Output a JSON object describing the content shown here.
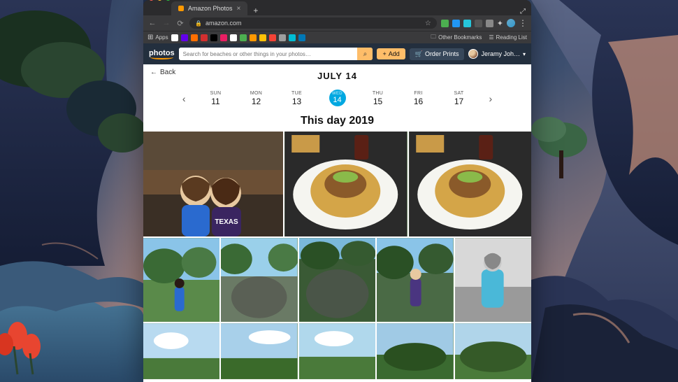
{
  "browser": {
    "tab_title": "Amazon Photos",
    "url_host": "amazon.com",
    "bookmarks": {
      "apps_label": "Apps",
      "other_label": "Other Bookmarks",
      "reading_label": "Reading List"
    }
  },
  "header": {
    "logo": "photos",
    "search_placeholder": "Search for beaches or other things in your photos…",
    "add_label": "Add",
    "order_label": "Order Prints",
    "user_name": "Jeramy Joh…"
  },
  "page": {
    "back_label": "Back",
    "title": "JULY 14",
    "year_heading": "This day 2019"
  },
  "days": [
    {
      "dow": "SUN",
      "num": "11",
      "selected": false
    },
    {
      "dow": "MON",
      "num": "12",
      "selected": false
    },
    {
      "dow": "TUE",
      "num": "13",
      "selected": false
    },
    {
      "dow": "WED",
      "num": "14",
      "selected": true
    },
    {
      "dow": "THU",
      "num": "15",
      "selected": false
    },
    {
      "dow": "FRI",
      "num": "16",
      "selected": false
    },
    {
      "dow": "SAT",
      "num": "17",
      "selected": false
    }
  ],
  "colors": {
    "accent": "#00a8e1",
    "amazon_orange": "#febd69",
    "header_bg": "#232f3e"
  }
}
